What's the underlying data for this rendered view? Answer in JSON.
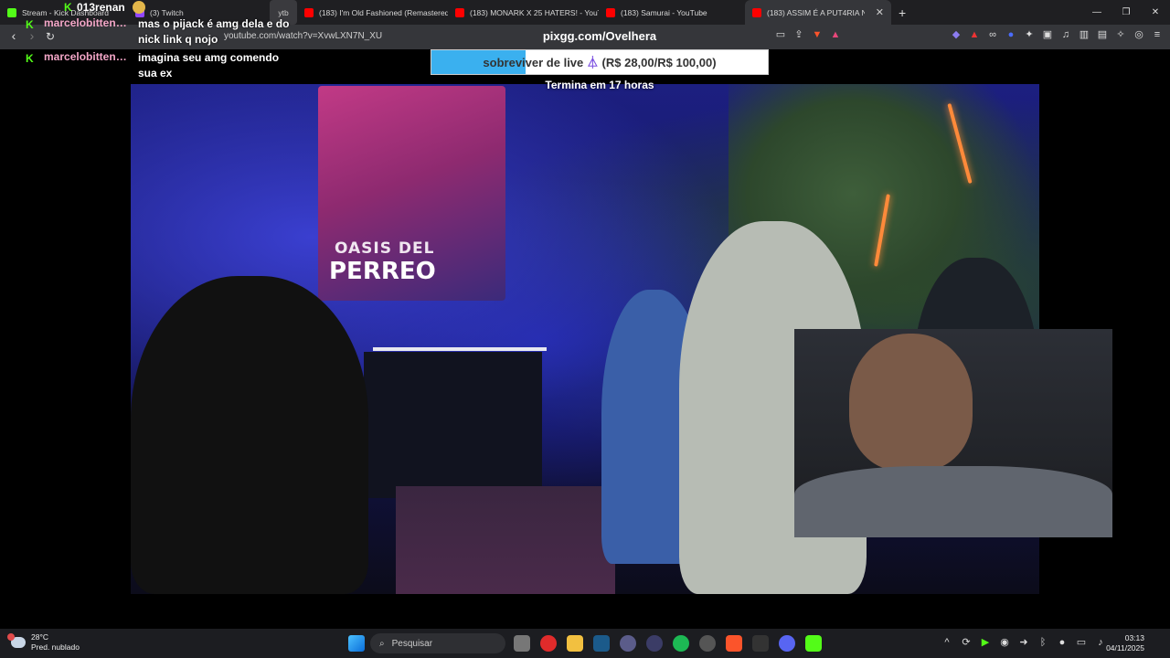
{
  "browser": {
    "tabs": [
      {
        "label": "Stream - Kick Dashboard",
        "color": "#53fc18"
      },
      {
        "label": "(3) Twitch",
        "color": "#9146ff"
      },
      {
        "label": "ytb",
        "color": "#444"
      },
      {
        "label": "(183) I'm Old Fashioned (Remastered)",
        "color": "#ff0000"
      },
      {
        "label": "(183) MONARK X 25 HATERS! - YouT",
        "color": "#ff0000"
      },
      {
        "label": "(183) Samurai - YouTube",
        "color": "#ff0000"
      },
      {
        "label": "(183) ASSIM É A PUT4RIA NO",
        "color": "#ff0000"
      }
    ],
    "url": "youtube.com/watch?v=XvwLXN7N_XU"
  },
  "overlay": {
    "top_user": "013renan",
    "pix_title": "pixgg.com/Ovelhera",
    "goal": {
      "label": "sobreviver de live",
      "amount": "(R$ 28,00/R$ 100,00)",
      "progress": 0.28,
      "ends": "Termina em 17 horas"
    },
    "chat": [
      {
        "user": "marcelobittenc...",
        "message": "mas o pijack é amg dela e do nick link q nojo"
      },
      {
        "user": "marcelobittenc...",
        "message": "imagina seu amg comendo sua ex"
      }
    ]
  },
  "video": {
    "banner_line1": "OASIS DEL",
    "banner_line2": "PERREO"
  },
  "taskbar": {
    "weather_temp": "28°C",
    "weather_desc": "Pred. nublado",
    "search_placeholder": "Pesquisar",
    "time": "03:13",
    "date": "04/11/2025"
  }
}
